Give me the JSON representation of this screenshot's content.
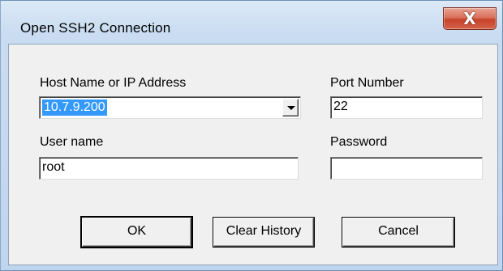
{
  "window": {
    "title": "Open SSH2 Connection",
    "close_glyph": "X"
  },
  "form": {
    "host_label": "Host Name or IP Address",
    "host_value": "10.7.9.200",
    "port_label": "Port Number",
    "port_value": "22",
    "user_label": "User name",
    "user_value": "root",
    "password_label": "Password",
    "password_value": ""
  },
  "buttons": {
    "ok": "OK",
    "clear_history": "Clear History",
    "cancel": "Cancel"
  },
  "colors": {
    "selection": "#3399ff",
    "close": "#c8432b",
    "client_bg": "#f0f0f0"
  }
}
